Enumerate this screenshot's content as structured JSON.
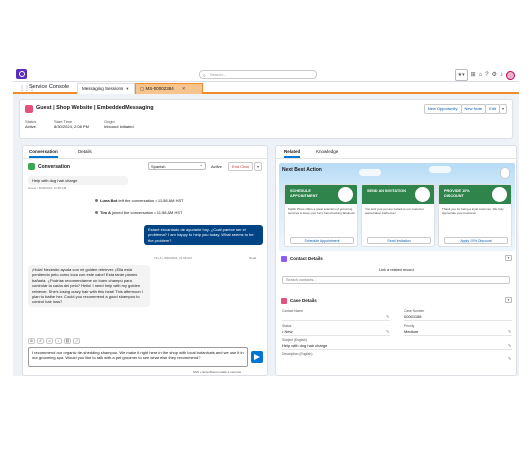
{
  "colors": {
    "brand": "#5a2dbd",
    "nav_accent": "#f28b2a",
    "primary": "#0176d3",
    "customer_bubble": "#014486",
    "recommendation_banner": "#2e844a"
  },
  "global_header": {
    "search_placeholder": "Search..."
  },
  "nav": {
    "app_name": "Service Console",
    "tabs": [
      {
        "label": "Messaging Sessions"
      },
      {
        "label": "MS-00002384"
      }
    ]
  },
  "highlights": {
    "title": "Guest | Shop Website | EmbeddedMessaging",
    "buttons": [
      "New Opportunity",
      "New Note",
      "Edit"
    ],
    "fields": [
      {
        "label": "Status",
        "value": "Active"
      },
      {
        "label": "Start Time",
        "value": "8/30/2024, 2:08 PM"
      },
      {
        "label": "Origin",
        "value": "Inbound Initiated"
      }
    ]
  },
  "left": {
    "tabs": [
      "Conversation",
      "Details"
    ],
    "conversation_label": "Conversation",
    "language_select": "Spanish",
    "active_label": "Active",
    "end_chat": "End Chat",
    "messages": [
      {
        "text": "Help with dog hair charge",
        "meta": "Guest • 8/30/2024, 11:58 AM"
      },
      {
        "event_actor": "Luna Bot",
        "event_text": "left the conversation • 11:58 AM HST"
      },
      {
        "event_actor": "Tim A",
        "event_text": "joined the conversation • 11:58 AM HST"
      },
      {
        "text": "Estaré encantado de ayudarle hoy. ¿Cuál parece ser el problema? I am happy to help you today. What seems to be the problem?",
        "meta": "Tim A • 8/30/2024, 11:58 AM",
        "status": "Read"
      },
      {
        "text": "¡Hola! Necesito ayuda con mi golden retriever. ¡Ella está perdiendo pelo como loca con este calor! Esta tarde planeo bañarla. ¿Podrías recomendarme un buen champú para controlar la caída del pelo? Hello! I need help with my golden retriever. She's losing crazy hair with this heat! This afternoon I plan to bathe her. Could you recommend a good shampoo to control hair loss?"
      }
    ],
    "composer_text": "I recommend our organic de-shedding shampoo. We make it right here in the shop with local botanicals and we use it in our grooming spa. Would you like to talk with a pet groomer to see what else they recommend?",
    "footnote": "Shift + Enter/Return adds a new line"
  },
  "right": {
    "tabs": [
      "Related",
      "Knowledge"
    ],
    "nba_title": "Next Best Action",
    "recommendations": [
      {
        "title": "SCHEDULE APPOINTMENT",
        "desc": "Kaitlin Pines offers a great selection of grooming services to keep your furry friend looking fabulous!",
        "button": "Schedule Appointment"
      },
      {
        "title": "SEND AN INVITATION",
        "desc": "You and your pet are invited to our customer appreciation barbecue!",
        "button": "Send Invitation"
      },
      {
        "title": "PROVIDE 10% DISCOUNT",
        "desc": "Thank you for being a loyal customer. We truly appreciate your business!",
        "button": "Apply 10% Discount"
      }
    ],
    "contact": {
      "title": "Contact Details",
      "link_prompt": "Link a related record.",
      "search_placeholder": "Search contacts..."
    },
    "case": {
      "title": "Case Details",
      "fields": [
        {
          "label": "Contact Name",
          "value": ""
        },
        {
          "label": "Case Number",
          "value": "00001158"
        },
        {
          "label": "Status",
          "value": "New"
        },
        {
          "label": "Priority",
          "value": "Medium"
        },
        {
          "label": "Subject (English)",
          "value": "Help with dog hair charge"
        },
        {
          "label": "Description (English)",
          "value": ""
        }
      ]
    }
  }
}
